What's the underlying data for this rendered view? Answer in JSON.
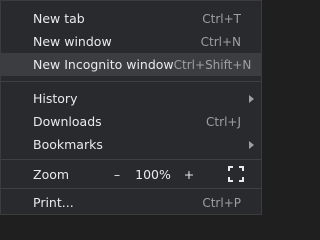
{
  "menu": {
    "new_tab": {
      "label": "New tab",
      "shortcut": "Ctrl+T"
    },
    "new_window": {
      "label": "New window",
      "shortcut": "Ctrl+N"
    },
    "new_incognito": {
      "label": "New Incognito window",
      "shortcut": "Ctrl+Shift+N"
    },
    "history": {
      "label": "History"
    },
    "downloads": {
      "label": "Downloads",
      "shortcut": "Ctrl+J"
    },
    "bookmarks": {
      "label": "Bookmarks"
    },
    "zoom": {
      "label": "Zoom",
      "minus": "–",
      "value": "100%",
      "plus": "+"
    },
    "print": {
      "label": "Print...",
      "shortcut": "Ctrl+P"
    }
  },
  "icons": {
    "submenu": "chevron-right-icon",
    "fullscreen": "fullscreen-icon"
  },
  "colors": {
    "background": "#292a2d",
    "hover": "#3c3d40",
    "text": "#e8eaed",
    "shortcut": "#9aa0a6",
    "separator": "#3f4043"
  }
}
